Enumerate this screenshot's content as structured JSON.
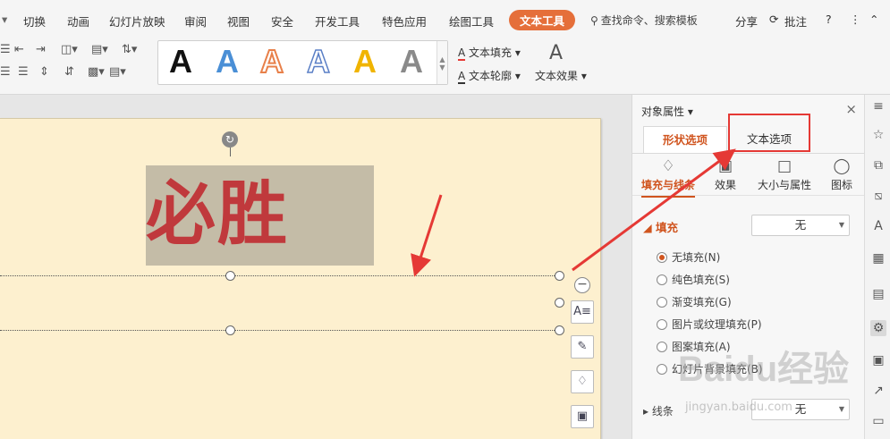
{
  "menu": {
    "items": [
      "切换",
      "动画",
      "幻灯片放映",
      "审阅",
      "视图",
      "安全",
      "开发工具",
      "特色应用",
      "绘图工具"
    ],
    "active_tab": "文本工具",
    "search_placeholder": "查找命令、搜索模板",
    "share": "分享",
    "comment": "批注",
    "help": "?"
  },
  "ribbon": {
    "art_letters": [
      "A",
      "A",
      "A",
      "A",
      "A",
      "A"
    ],
    "text_fill": "文本填充",
    "text_outline": "文本轮廓",
    "text_effect": "文本效果"
  },
  "slide": {
    "text": "必胜"
  },
  "pane": {
    "title": "对象属性",
    "tab_shape": "形状选项",
    "tab_text": "文本选项",
    "subtabs": [
      "填充与线条",
      "效果",
      "大小与属性",
      "图标"
    ],
    "fill_section": "填充",
    "fill_value": "无",
    "fill_options": [
      "无填充(N)",
      "纯色填充(S)",
      "渐变填充(G)",
      "图片或纹理填充(P)",
      "图案填充(A)",
      "幻灯片背景填充(B)"
    ],
    "line_label": "线条",
    "line_value": "无"
  },
  "watermark": {
    "logo": "Baidu经验",
    "url": "jingyan.baidu.com"
  },
  "colors": {
    "accent": "#e56f3a",
    "slide_bg": "#fdf0cf",
    "text_red": "#c0393c",
    "highlight_box": "#e53935"
  }
}
